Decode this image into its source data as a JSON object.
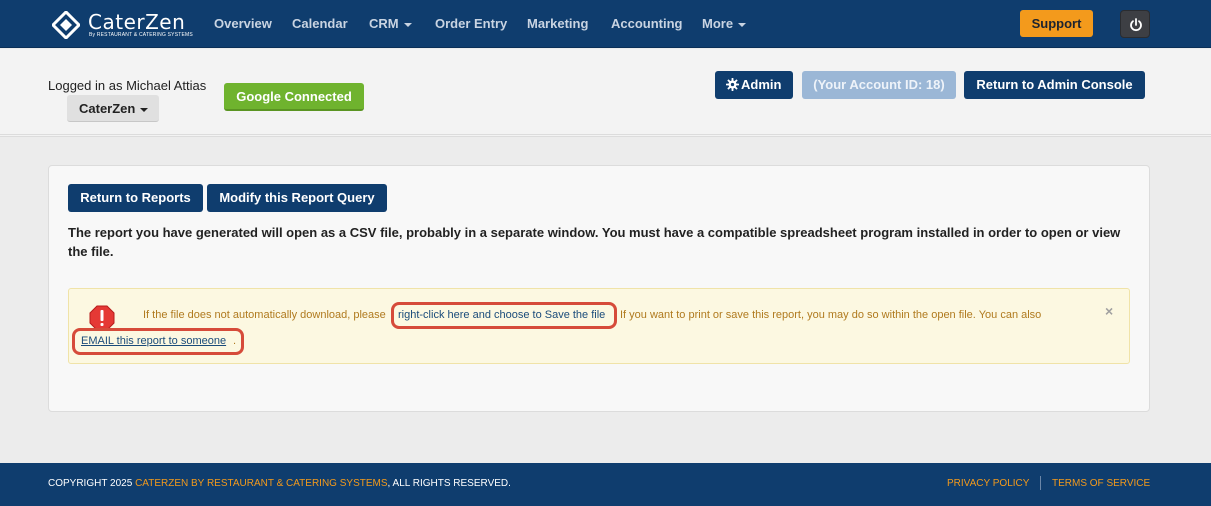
{
  "brand": {
    "name": "CaterZen",
    "tagline": "By RESTAURANT & CATERING SYSTEMS"
  },
  "nav": {
    "items": [
      "Overview",
      "Calendar",
      "CRM",
      "Order Entry",
      "Marketing",
      "Accounting",
      "More"
    ],
    "support_label": "Support",
    "power_icon": "power-icon"
  },
  "header": {
    "logged_in_text": "Logged in as Michael Attias",
    "account_name": "CaterZen",
    "google_label": "Google Connected",
    "admin_label": "Admin",
    "account_id_label": "(Your Account ID: 18)",
    "return_admin_label": "Return to Admin Console"
  },
  "report": {
    "return_label": "Return to Reports",
    "modify_label": "Modify this Report Query",
    "message": "The report you have generated will open as a CSV file, probably in a separate window. You must have a compatible spreadsheet program installed in order to open or view the file."
  },
  "alert": {
    "text_before": "If the file does not automatically download, please",
    "link_save": "right-click here and choose to Save the file",
    "text_after": "If you want to print or save this report, you may do so within the open file. You can also",
    "link_email": "EMAIL this report to someone",
    "period": ".",
    "close": "×"
  },
  "footer": {
    "copyright_prefix": "COPYRIGHT 2025",
    "copyright_brand": "CATERZEN BY RESTAURANT & CATERING SYSTEMS",
    "copyright_suffix": ", ALL RIGHTS RESERVED.",
    "privacy": "PRIVACY POLICY",
    "terms": "TERMS OF SERVICE"
  },
  "colors": {
    "navy": "#0f3d6e",
    "orange": "#f39a1c",
    "green": "#6fb32e",
    "alert_bg": "#fcf8e1",
    "highlight": "#d64b3a"
  }
}
